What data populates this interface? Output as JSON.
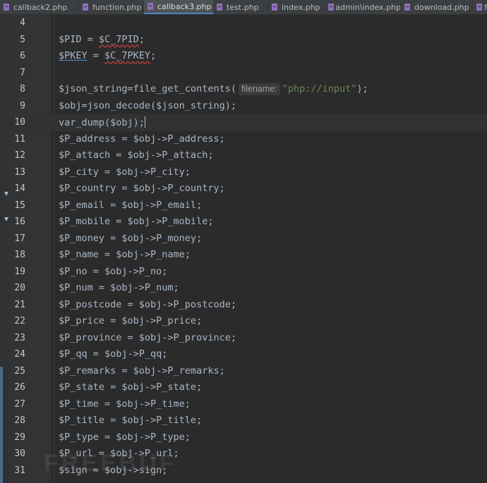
{
  "tabs": [
    {
      "label": "callback2.php",
      "active": false
    },
    {
      "label": "function.php",
      "active": false
    },
    {
      "label": "callback3.php",
      "active": true
    },
    {
      "label": "test.php",
      "active": false
    },
    {
      "label": "index.php",
      "active": false
    },
    {
      "label": "admin\\index.php",
      "active": false
    },
    {
      "label": "download.php",
      "active": false
    },
    {
      "label": "f",
      "active": false
    }
  ],
  "editor": {
    "current_line": 10,
    "lines": [
      {
        "num": "4"
      },
      {
        "num": "5",
        "a": "$PID = ",
        "b": "$C_7PID",
        ";": ";"
      },
      {
        "num": "6",
        "a": "$PKEY",
        "b": " = ",
        "c": "$C_7PKEY",
        ";": ";"
      },
      {
        "num": "7"
      },
      {
        "num": "8",
        "a": "$json_string=file_get_contents(",
        "hint": "filename:",
        "s": "\"php://input\"",
        "end": ");"
      },
      {
        "num": "9",
        "a": "$obj=json_decode($json_string);"
      },
      {
        "num": "10",
        "a": "var_dump($obj);"
      },
      {
        "num": "11",
        "a": "$P_address = $obj->P_address;"
      },
      {
        "num": "12",
        "a": "$P_attach = $obj->P_attach;"
      },
      {
        "num": "13",
        "a": "$P_city = $obj->P_city;"
      },
      {
        "num": "14",
        "a": "$P_country = $obj->P_country;"
      },
      {
        "num": "15",
        "a": "$P_email = $obj->P_email;"
      },
      {
        "num": "16",
        "a": "$P_mobile = $obj->P_mobile;"
      },
      {
        "num": "17",
        "a": "$P_money = $obj->P_money;"
      },
      {
        "num": "18",
        "a": "$P_name = $obj->P_name;"
      },
      {
        "num": "19",
        "a": "$P_no = $obj->P_no;"
      },
      {
        "num": "20",
        "a": "$P_num = $obj->P_num;"
      },
      {
        "num": "21",
        "a": "$P_postcode = $obj->P_postcode;"
      },
      {
        "num": "22",
        "a": "$P_price = $obj->P_price;"
      },
      {
        "num": "23",
        "a": "$P_province = $obj->P_province;"
      },
      {
        "num": "24",
        "a": "$P_qq = $obj->P_qq;"
      },
      {
        "num": "25",
        "a": "$P_remarks = $obj->P_remarks;"
      },
      {
        "num": "26",
        "a": "$P_state = $obj->P_state;"
      },
      {
        "num": "27",
        "a": "$P_time = $obj->P_time;"
      },
      {
        "num": "28",
        "a": "$P_title = $obj->P_title;"
      },
      {
        "num": "29",
        "a": "$P_type = $obj->P_type;"
      },
      {
        "num": "30",
        "a": "$P_url = $obj->P_url;"
      },
      {
        "num": "31",
        "a": "$sign = $obj->sign;"
      }
    ]
  },
  "watermark": "FREEBUF",
  "icons": {
    "tab_file": "php-file-icon",
    "fold": "fold-arrow-icon"
  }
}
